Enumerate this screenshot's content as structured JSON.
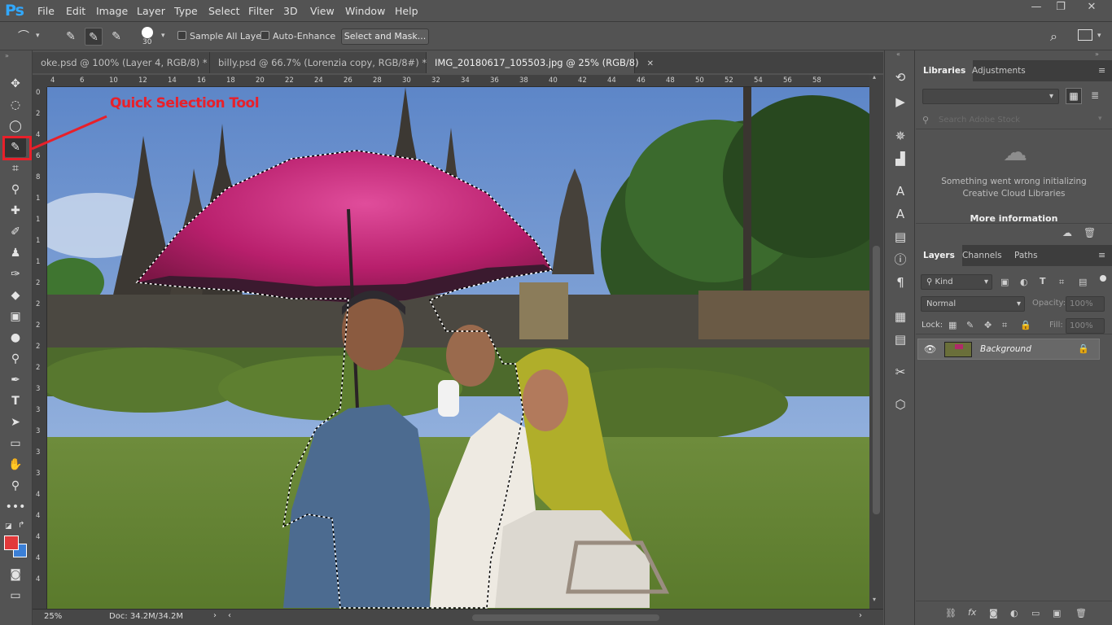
{
  "app": {
    "logo": "Ps"
  },
  "menu": [
    "File",
    "Edit",
    "Image",
    "Layer",
    "Type",
    "Select",
    "Filter",
    "3D",
    "View",
    "Window",
    "Help"
  ],
  "window_controls": {
    "minimize": "—",
    "restore": "❐",
    "close": "✕"
  },
  "options_bar": {
    "brush_size": "30",
    "sample_all_layers": "Sample All Layers",
    "auto_enhance": "Auto-Enhance",
    "select_and_mask": "Select and Mask..."
  },
  "tabs": [
    {
      "label": "oke.psd @ 100% (Layer 4, RGB/8) *",
      "close": "✕"
    },
    {
      "label": "billy.psd @ 66.7% (Lorenzia copy, RGB/8#) *",
      "close": "✕"
    },
    {
      "label": "IMG_20180617_105503.jpg @ 25% (RGB/8)",
      "close": "✕"
    }
  ],
  "ruler_h": [
    "4",
    "6",
    "10",
    "12",
    "14",
    "16",
    "18",
    "20",
    "22",
    "24",
    "26",
    "28",
    "30",
    "32",
    "34",
    "36",
    "38",
    "40",
    "42",
    "44",
    "46",
    "48",
    "50",
    "52",
    "54",
    "56",
    "58"
  ],
  "ruler_v": [
    "0",
    "2",
    "4",
    "6",
    "8",
    "1",
    "1",
    "1",
    "1",
    "2",
    "2",
    "2",
    "2",
    "2",
    "3",
    "3",
    "3",
    "3",
    "3",
    "4",
    "4",
    "4",
    "4",
    "4"
  ],
  "annotation": {
    "text": "Quick Selection Tool",
    "color": "#e8202a"
  },
  "status": {
    "zoom": "25%",
    "doc": "Doc: 34.2M/34.2M"
  },
  "libraries": {
    "tabs": [
      "Libraries",
      "Adjustments"
    ],
    "search_placeholder": "Search Adobe Stock",
    "error_line1": "Something went wrong initializing",
    "error_line2": "Creative Cloud Libraries",
    "more_info": "More information"
  },
  "layers": {
    "tabs": [
      "Layers",
      "Channels",
      "Paths"
    ],
    "kind": "Kind",
    "blend_mode": "Normal",
    "opacity_label": "Opacity:",
    "opacity_value": "100%",
    "lock_label": "Lock:",
    "fill_label": "Fill:",
    "fill_value": "100%",
    "items": [
      {
        "name": "Background"
      }
    ]
  },
  "colors": {
    "foreground": "#e2393a",
    "background": "#3b7fd6",
    "accent": "#31a8ff"
  }
}
